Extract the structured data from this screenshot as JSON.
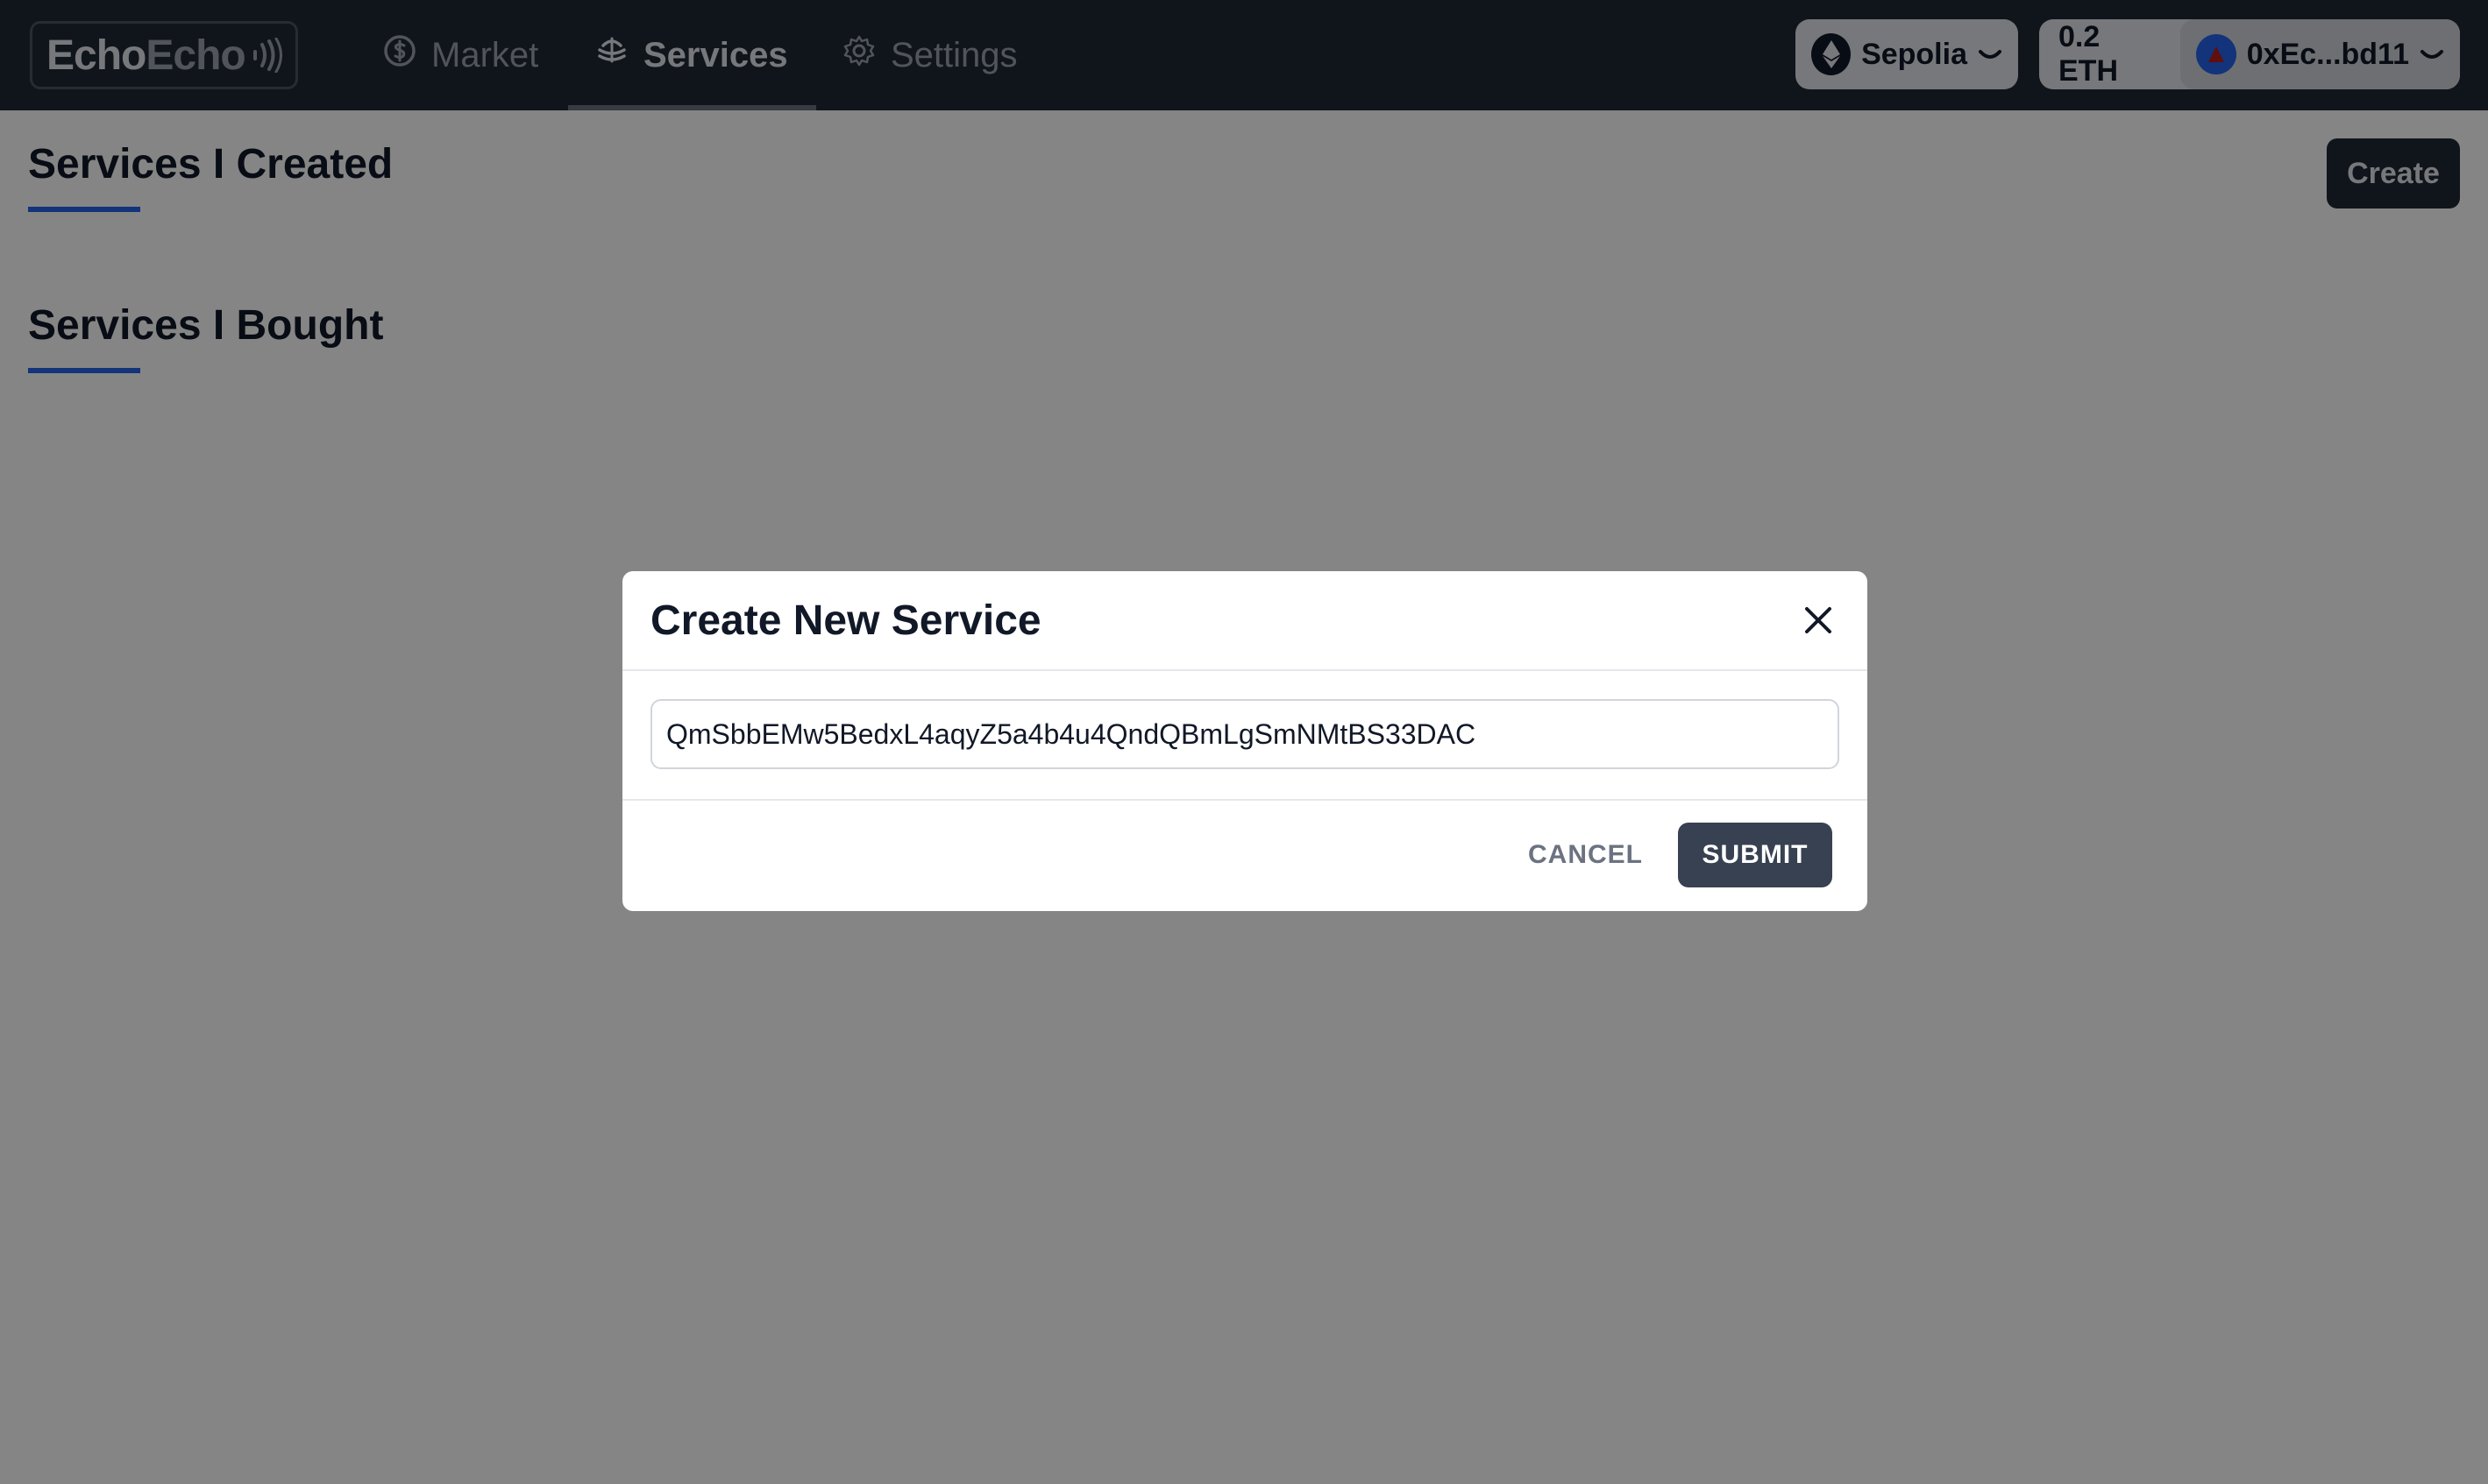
{
  "header": {
    "logo": {
      "part1": "Echo",
      "part2": "Echo"
    },
    "nav": [
      {
        "label": "Market",
        "icon": "dollar-circle-icon"
      },
      {
        "label": "Services",
        "icon": "services-stack-icon",
        "active": true
      },
      {
        "label": "Settings",
        "icon": "gear-icon"
      }
    ],
    "network": {
      "label": "Sepolia",
      "icon": "ethereum-icon"
    },
    "wallet": {
      "balance": "0.2 ETH",
      "address": "0xEc...bd11"
    }
  },
  "main": {
    "created_title": "Services I Created",
    "bought_title": "Services I Bought",
    "create_label": "Create"
  },
  "modal": {
    "title": "Create New Service",
    "input_value": "QmSbbEMw5BedxL4aqyZ5a4b4u4QndQBmLgSmNMtBS33DAC",
    "cancel_label": "CANCEL",
    "submit_label": "SUBMIT"
  },
  "colors": {
    "nav_bg": "#1f2937",
    "accent_blue": "#2563eb",
    "submit_bg": "#374151"
  }
}
